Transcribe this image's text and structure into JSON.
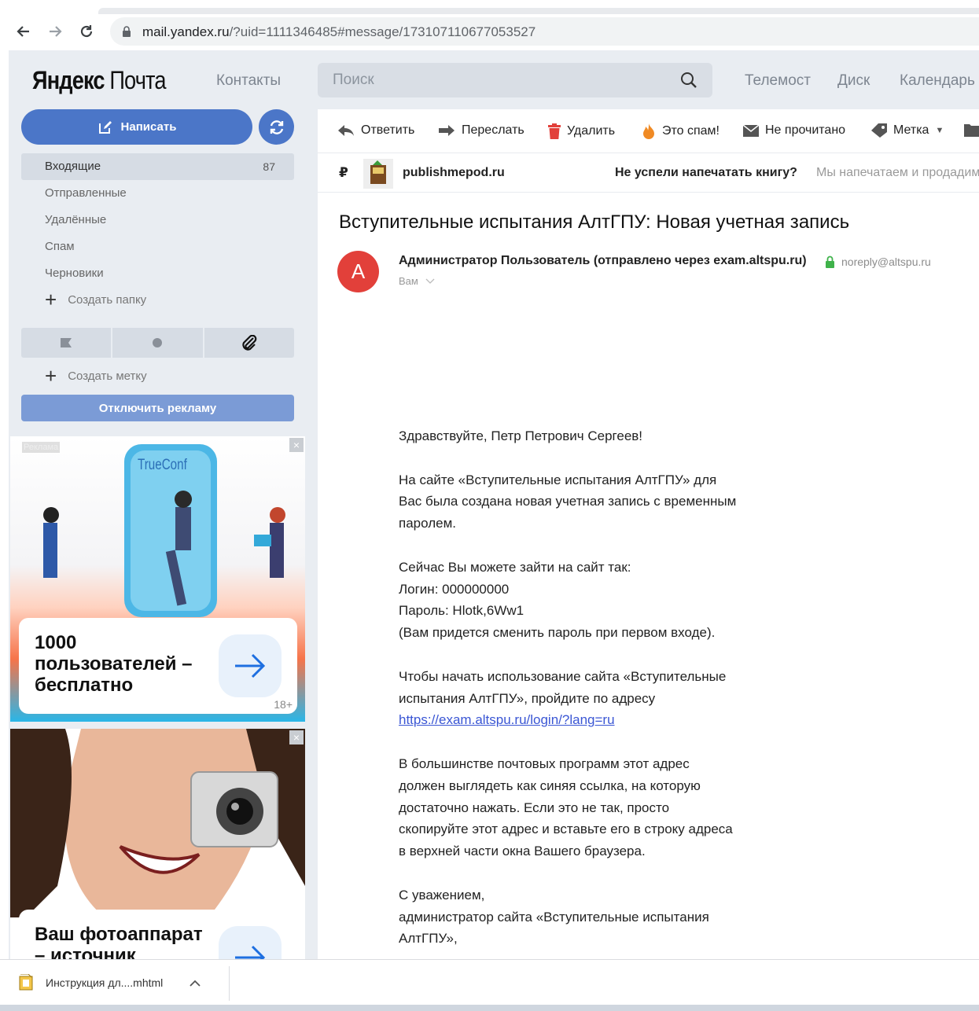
{
  "browser": {
    "url_domain": "mail.yandex.ru",
    "url_rest": "/?uid=1111346485#message/173107110677053527"
  },
  "header": {
    "logo_brand": "Яндекс",
    "logo_product": "Почта",
    "contacts": "Контакты",
    "search_placeholder": "Поиск",
    "services": [
      "Телемост",
      "Диск",
      "Календарь"
    ]
  },
  "sidebar": {
    "compose_label": "Написать",
    "folders": [
      {
        "label": "Входящие",
        "count": "87"
      },
      {
        "label": "Отправленные"
      },
      {
        "label": "Удалённые"
      },
      {
        "label": "Спам"
      },
      {
        "label": "Черновики"
      }
    ],
    "create_folder": "Создать папку",
    "create_label": "Создать метку",
    "disable_ads": "Отключить рекламу"
  },
  "ads": {
    "label": "Реклама",
    "ad1_brand": "TrueConf",
    "ad1_headline": "1000 пользователей – бесплатно",
    "ad1_age": "18+",
    "ad2_headline": "Ваш фотоаппарат – источник"
  },
  "toolbar": {
    "reply": "Ответить",
    "forward": "Переслать",
    "delete": "Удалить",
    "spam": "Это спам!",
    "unread": "Не прочитано",
    "label": "Метка"
  },
  "ad_strip": {
    "sender": "publishmepod.ru",
    "title": "Не успели напечатать книгу?",
    "snippet": "Мы напечатаем и продадим"
  },
  "message": {
    "subject": "Вступительные испытания АлтГПУ: Новая учетная запись",
    "avatar_letter": "A",
    "sender": "Администратор Пользователь (отправлено через exam.altspu.ru)",
    "sender_email": "noreply@altspu.ru",
    "recipient": "Вам",
    "body": {
      "greeting": "Здравствуйте, Петр Петрович Сергеев!",
      "p1": "На сайте «Вступительные испытания АлтГПУ» для Вас была создана новая учетная запись с временным паролем.",
      "p2_intro": "Сейчас Вы можете зайти на сайт так:",
      "login": "Логин: 000000000",
      "password": "Пароль: Hlotk,6Ww1",
      "p2_note": "(Вам придется сменить пароль при первом входе).",
      "p3": "Чтобы начать использование сайта «Вступительные испытания АлтГПУ», пройдите по адресу",
      "link": "https://exam.altspu.ru/login/?lang=ru",
      "p4": "В большинстве почтовых программ этот адрес должен выглядеть как синяя ссылка, на которую достаточно нажать. Если это не так, просто скопируйте этот адрес и вставьте его в строку адреса в верхней части окна Вашего браузера.",
      "sign1": "С уважением,",
      "sign2": "администратор сайта «Вступительные испытания АлтГПУ»,"
    }
  },
  "downloads": {
    "file": "Инструкция дл....mhtml"
  },
  "colors": {
    "accent": "#4b76c8",
    "avatar": "#e2403a",
    "link": "#3a56d4"
  }
}
